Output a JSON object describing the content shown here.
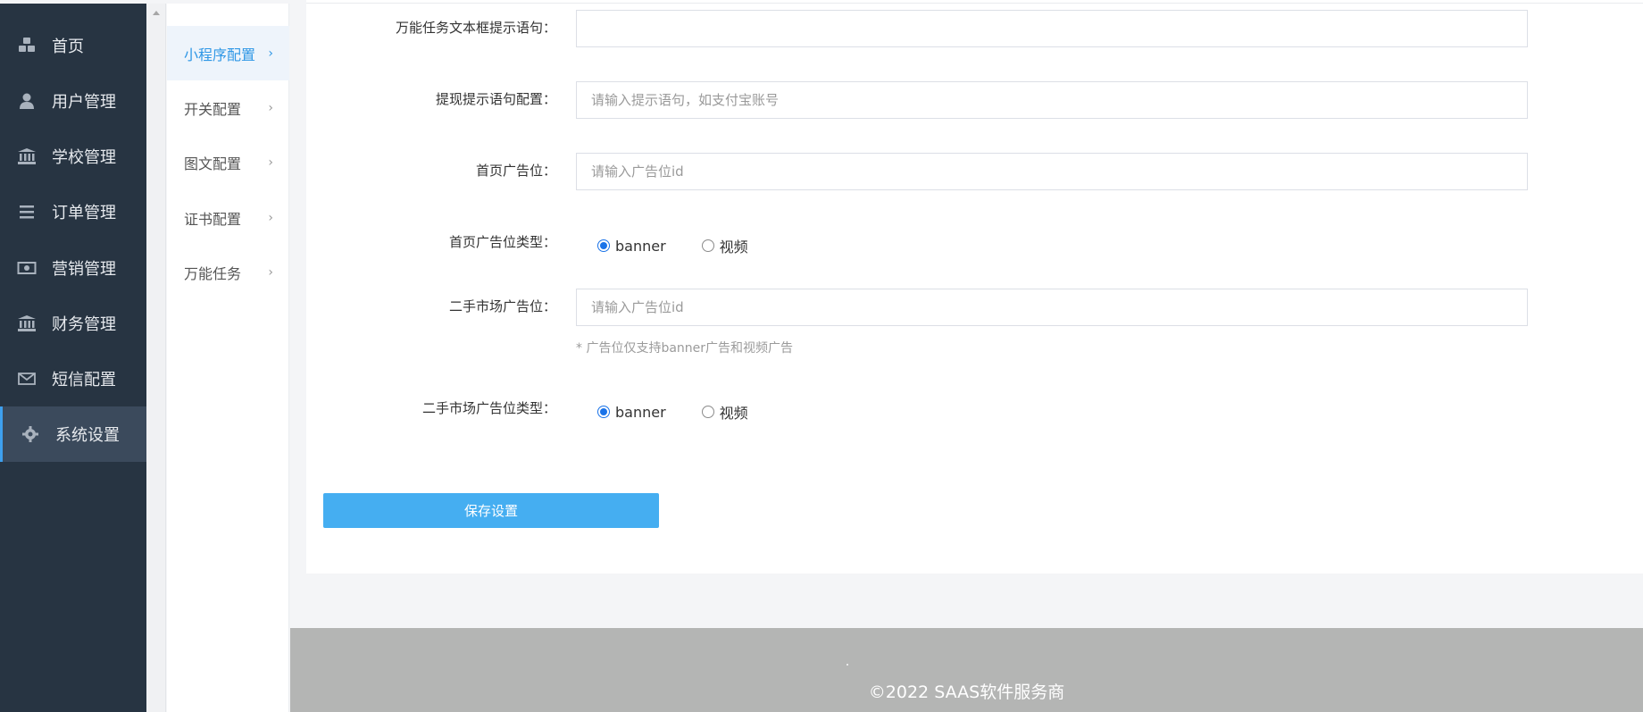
{
  "sidebar": {
    "items": [
      {
        "label": "首页",
        "icon": "cubes-icon"
      },
      {
        "label": "用户管理",
        "icon": "user-icon"
      },
      {
        "label": "学校管理",
        "icon": "institution-icon"
      },
      {
        "label": "订单管理",
        "icon": "list-icon"
      },
      {
        "label": "营销管理",
        "icon": "money-icon"
      },
      {
        "label": "财务管理",
        "icon": "institution-icon"
      },
      {
        "label": "短信配置",
        "icon": "envelope-icon"
      },
      {
        "label": "系统设置",
        "icon": "gear-icon",
        "active": true
      }
    ]
  },
  "submenu": {
    "items": [
      {
        "label": "小程序配置",
        "active": true
      },
      {
        "label": "开关配置"
      },
      {
        "label": "图文配置"
      },
      {
        "label": "证书配置"
      },
      {
        "label": "万能任务"
      }
    ],
    "chevron": "›"
  },
  "form": {
    "task_prompt": {
      "label": "万能任务文本框提示语句：",
      "value": "",
      "placeholder": ""
    },
    "withdraw_prompt": {
      "label": "提现提示语句配置：",
      "value": "",
      "placeholder": "请输入提示语句，如支付宝账号"
    },
    "home_ad": {
      "label": "首页广告位：",
      "value": "",
      "placeholder": "请输入广告位id"
    },
    "home_ad_type": {
      "label": "首页广告位类型：",
      "options": [
        "banner",
        "视频"
      ],
      "selected": "banner"
    },
    "market_ad": {
      "label": "二手市场广告位：",
      "value": "",
      "placeholder": "请输入广告位id"
    },
    "market_ad_hint": "* 广告位仅支持banner广告和视频广告",
    "market_ad_type": {
      "label": "二手市场广告位类型：",
      "options": [
        "banner",
        "视频"
      ],
      "selected": "banner"
    },
    "save_label": "保存设置"
  },
  "footer": {
    "text": "©2022 SAAS软件服务商"
  },
  "colors": {
    "sidebar_bg": "#273442",
    "accent": "#2f97e6",
    "button": "#45aef1",
    "footer_bg": "#b4b5b4"
  }
}
